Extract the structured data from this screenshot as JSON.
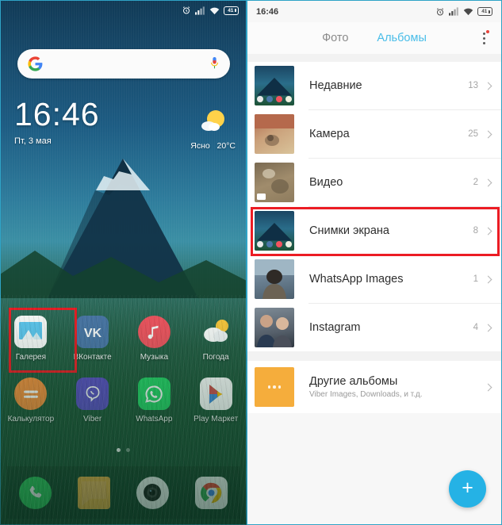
{
  "left_phone": {
    "status_bar": {
      "icons": [
        "alarm-icon",
        "signal-icon",
        "wifi-icon",
        "battery-icon"
      ],
      "battery_level": "41"
    },
    "search": {
      "placeholder": "",
      "google_icon": "google-g-icon",
      "mic_icon": "microphone-icon"
    },
    "clock_widget": {
      "time": "16:46",
      "date": "Пт, 3 мая"
    },
    "weather_widget": {
      "condition": "Ясно",
      "temperature": "20°C",
      "icon": "sun-cloud-icon"
    },
    "apps": [
      [
        {
          "label": "Галерея",
          "icon": "gallery-icon",
          "highlighted": true
        },
        {
          "label": "ВКонтакте",
          "icon": "vk-icon",
          "highlighted": false
        },
        {
          "label": "Музыка",
          "icon": "music-icon",
          "highlighted": false
        },
        {
          "label": "Погода",
          "icon": "weather-icon",
          "highlighted": false
        }
      ],
      [
        {
          "label": "Калькулятор",
          "icon": "calculator-icon",
          "highlighted": false
        },
        {
          "label": "Viber",
          "icon": "viber-icon",
          "highlighted": false
        },
        {
          "label": "WhatsApp",
          "icon": "whatsapp-icon",
          "highlighted": false
        },
        {
          "label": "Play Маркет",
          "icon": "play-store-icon",
          "highlighted": false
        }
      ]
    ],
    "page_dots": {
      "count": 2,
      "active_index": 0
    },
    "dock": [
      {
        "icon": "phone-icon"
      },
      {
        "icon": "messages-icon"
      },
      {
        "icon": "camera-icon"
      },
      {
        "icon": "chrome-icon"
      }
    ]
  },
  "right_phone": {
    "status_bar": {
      "time": "16:46",
      "battery_level": "41"
    },
    "tabs": [
      {
        "label": "Фото",
        "active": false
      },
      {
        "label": "Альбомы",
        "active": true
      }
    ],
    "overflow_menu": {
      "icon": "kebab-menu-icon",
      "has_badge": true
    },
    "albums": [
      {
        "title": "Недавние",
        "count": "13",
        "thumb": "home-screenshot"
      },
      {
        "title": "Камера",
        "count": "25",
        "thumb": "photo-brick"
      },
      {
        "title": "Видео",
        "count": "2",
        "thumb": "photo-video"
      },
      {
        "title": "Снимки экрана",
        "count": "8",
        "thumb": "home-screenshot",
        "highlighted": true
      },
      {
        "title": "WhatsApp Images",
        "count": "1",
        "thumb": "photo-person"
      },
      {
        "title": "Instagram",
        "count": "4",
        "thumb": "photo-selfie"
      }
    ],
    "other_albums": {
      "title": "Другие альбомы",
      "subtitle": "Viber Images, Downloads, и т.д.",
      "thumb": "ellipsis-tile"
    },
    "fab": {
      "label": "+",
      "icon": "plus-icon",
      "color": "#25b2e5"
    }
  },
  "colors": {
    "accent_blue": "#49bde8",
    "fab_blue": "#25b2e5",
    "highlight_red": "#ec1c24",
    "orange_tile": "#f5ad3c"
  }
}
